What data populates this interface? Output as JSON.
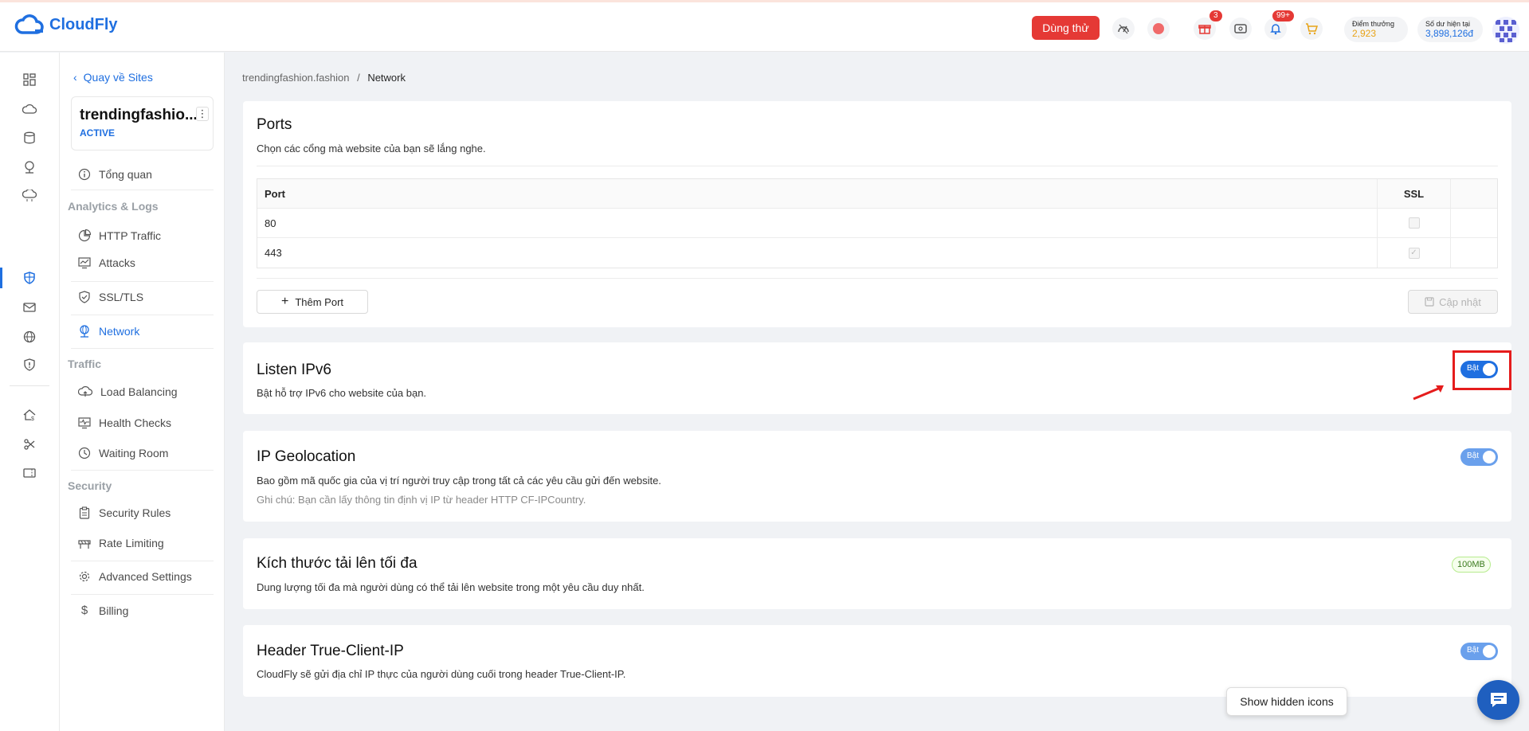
{
  "header": {
    "logo_text": "CloudFly",
    "trial_button": "Dùng thử",
    "gift_badge": "3",
    "bell_badge": "99+",
    "reward_points_label": "Điểm thưởng",
    "reward_points_value": "2,923",
    "balance_label": "Số dư hiện tại",
    "balance_value": "3,898,126đ",
    "colors": {
      "brand": "#1f6fe0",
      "trial": "#e53935",
      "points": "#e8a317"
    }
  },
  "sidebar": {
    "back_label": "Quay về Sites",
    "site_name": "trendingfashio...",
    "site_status": "ACTIVE",
    "overview": "Tổng quan",
    "section_analytics": "Analytics & Logs",
    "http_traffic": "HTTP Traffic",
    "attacks": "Attacks",
    "ssl_tls": "SSL/TLS",
    "network": "Network",
    "section_traffic": "Traffic",
    "load_balancing": "Load Balancing",
    "health_checks": "Health Checks",
    "waiting_room": "Waiting Room",
    "section_security": "Security",
    "security_rules": "Security Rules",
    "rate_limiting": "Rate Limiting",
    "advanced_settings": "Advanced Settings",
    "billing": "Billing"
  },
  "breadcrumb": {
    "site": "trendingfashion.fashion",
    "separator": "/",
    "current": "Network"
  },
  "ports": {
    "title": "Ports",
    "description": "Chọn các cổng mà website của bạn sẽ lắng nghe.",
    "col_port": "Port",
    "col_ssl": "SSL",
    "rows": [
      {
        "port": "80",
        "ssl": false
      },
      {
        "port": "443",
        "ssl": true
      }
    ],
    "add_button": "Thêm Port",
    "update_button": "Cập nhật"
  },
  "ipv6": {
    "title": "Listen IPv6",
    "description": "Bật hỗ trợ IPv6 cho website của bạn.",
    "toggle_label": "Bật",
    "enabled": true
  },
  "geolocation": {
    "title": "IP Geolocation",
    "description": "Bao gồm mã quốc gia của vị trí người truy cập trong tất cả các yêu cầu gửi đến website.",
    "note": "Ghi chú: Bạn cần lấy thông tin định vị IP từ header HTTP CF-IPCountry.",
    "toggle_label": "Bật",
    "enabled": true
  },
  "upload_size": {
    "title": "Kích thước tải lên tối đa",
    "description": "Dung lượng tối đa mà người dùng có thể tải lên website trong một yêu cầu duy nhất.",
    "value": "100MB"
  },
  "true_client_ip": {
    "title": "Header True-Client-IP",
    "description": "CloudFly sẽ gửi địa chỉ IP thực của người dùng cuối trong header True-Client-IP.",
    "toggle_label": "Bật",
    "enabled": true
  },
  "tooltip": "Show hidden icons"
}
